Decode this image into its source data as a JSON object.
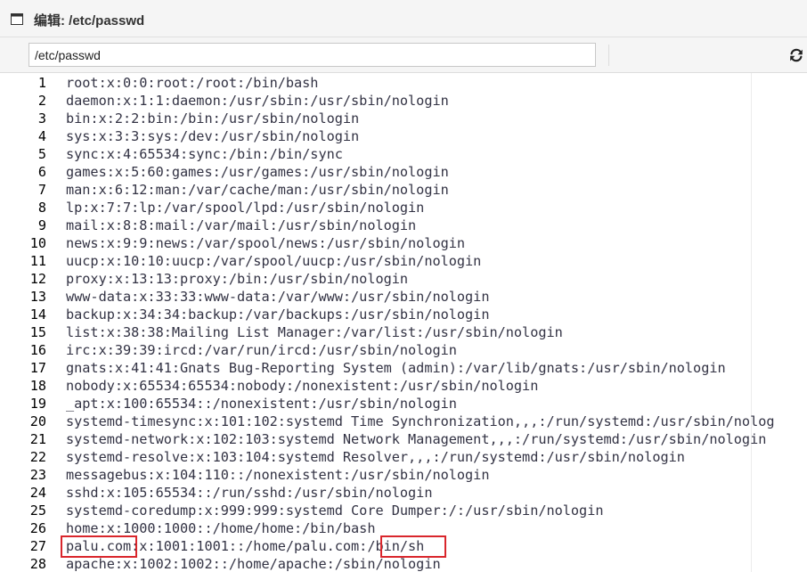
{
  "window": {
    "title": "编辑: /etc/passwd"
  },
  "toolbar": {
    "path_value": "/etc/passwd"
  },
  "editor": {
    "lines": [
      {
        "n": "1",
        "text": "root:x:0:0:root:/root:/bin/bash"
      },
      {
        "n": "2",
        "text": "daemon:x:1:1:daemon:/usr/sbin:/usr/sbin/nologin"
      },
      {
        "n": "3",
        "text": "bin:x:2:2:bin:/bin:/usr/sbin/nologin"
      },
      {
        "n": "4",
        "text": "sys:x:3:3:sys:/dev:/usr/sbin/nologin"
      },
      {
        "n": "5",
        "text": "sync:x:4:65534:sync:/bin:/bin/sync"
      },
      {
        "n": "6",
        "text": "games:x:5:60:games:/usr/games:/usr/sbin/nologin"
      },
      {
        "n": "7",
        "text": "man:x:6:12:man:/var/cache/man:/usr/sbin/nologin"
      },
      {
        "n": "8",
        "text": "lp:x:7:7:lp:/var/spool/lpd:/usr/sbin/nologin"
      },
      {
        "n": "9",
        "text": "mail:x:8:8:mail:/var/mail:/usr/sbin/nologin"
      },
      {
        "n": "10",
        "text": "news:x:9:9:news:/var/spool/news:/usr/sbin/nologin"
      },
      {
        "n": "11",
        "text": "uucp:x:10:10:uucp:/var/spool/uucp:/usr/sbin/nologin"
      },
      {
        "n": "12",
        "text": "proxy:x:13:13:proxy:/bin:/usr/sbin/nologin"
      },
      {
        "n": "13",
        "text": "www-data:x:33:33:www-data:/var/www:/usr/sbin/nologin"
      },
      {
        "n": "14",
        "text": "backup:x:34:34:backup:/var/backups:/usr/sbin/nologin"
      },
      {
        "n": "15",
        "text": "list:x:38:38:Mailing List Manager:/var/list:/usr/sbin/nologin"
      },
      {
        "n": "16",
        "text": "irc:x:39:39:ircd:/var/run/ircd:/usr/sbin/nologin"
      },
      {
        "n": "17",
        "text": "gnats:x:41:41:Gnats Bug-Reporting System (admin):/var/lib/gnats:/usr/sbin/nologin"
      },
      {
        "n": "18",
        "text": "nobody:x:65534:65534:nobody:/nonexistent:/usr/sbin/nologin"
      },
      {
        "n": "19",
        "text": "_apt:x:100:65534::/nonexistent:/usr/sbin/nologin"
      },
      {
        "n": "20",
        "text": "systemd-timesync:x:101:102:systemd Time Synchronization,,,:/run/systemd:/usr/sbin/nolog"
      },
      {
        "n": "21",
        "text": "systemd-network:x:102:103:systemd Network Management,,,:/run/systemd:/usr/sbin/nologin"
      },
      {
        "n": "22",
        "text": "systemd-resolve:x:103:104:systemd Resolver,,,:/run/systemd:/usr/sbin/nologin"
      },
      {
        "n": "23",
        "text": "messagebus:x:104:110::/nonexistent:/usr/sbin/nologin"
      },
      {
        "n": "24",
        "text": "sshd:x:105:65534::/run/sshd:/usr/sbin/nologin"
      },
      {
        "n": "25",
        "text": "systemd-coredump:x:999:999:systemd Core Dumper:/:/usr/sbin/nologin"
      },
      {
        "n": "26",
        "text": "home:x:1000:1000::/home/home:/bin/bash"
      },
      {
        "n": "27",
        "text": "palu.com:x:1001:1001::/home/palu.com:/bin/sh"
      },
      {
        "n": "28",
        "text": "apache:x:1002:1002::/home/apache:/sbin/nologin"
      }
    ]
  },
  "colors": {
    "highlight_border": "#d9262c",
    "line_number": "#000000",
    "code_text": "#333344"
  }
}
